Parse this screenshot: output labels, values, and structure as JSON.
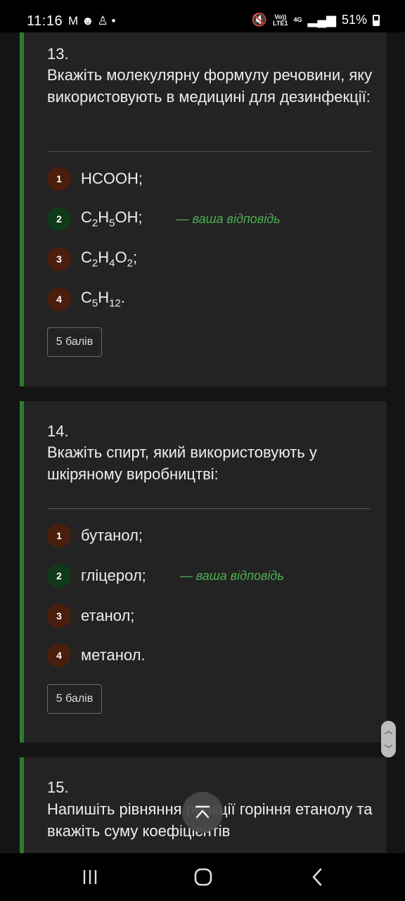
{
  "status_bar": {
    "time": "11:16",
    "notification_icons": [
      "mail-icon",
      "panda-icon",
      "person-icon",
      "dot-icon"
    ],
    "volte_top": "Vo))",
    "volte_bottom": "LTE1",
    "network": "4G",
    "battery": "51%"
  },
  "questions": [
    {
      "number": "13.",
      "text": "Вкажіть молекулярну формулу речовини, яку використовують в медицині для дезинфекції:",
      "options": [
        {
          "index": "1",
          "label_html": "HCOOH;"
        },
        {
          "index": "2",
          "label_html": "C<sub>2</sub>H<sub>5</sub>OH;",
          "selected": true
        },
        {
          "index": "3",
          "label_html": "C<sub>2</sub>H<sub>4</sub>O<sub>2</sub>;"
        },
        {
          "index": "4",
          "label_html": "C<sub>5</sub>H<sub>12</sub>."
        }
      ],
      "your_answer_label": "— ваша відповідь",
      "points": "5 балів"
    },
    {
      "number": "14.",
      "text": "Вкажіть спирт, який використовують у шкіряному виробництві:",
      "options": [
        {
          "index": "1",
          "label_html": "бутанол;"
        },
        {
          "index": "2",
          "label_html": "гліцерол;",
          "selected": true
        },
        {
          "index": "3",
          "label_html": "етанол;"
        },
        {
          "index": "4",
          "label_html": "метанол."
        }
      ],
      "your_answer_label": "— ваша відповідь",
      "points": "5 балів"
    },
    {
      "number": "15.",
      "text": "Напишіть рівняння реакції горіння етанолу та вкажіть суму коефіцієнтів"
    }
  ],
  "colors": {
    "accent_green": "#2a7d2e",
    "answer_green": "#4caf50",
    "badge_brown": "#4a1e0c",
    "badge_green": "#0f3a18"
  },
  "fab": {
    "icon": "scroll-to-top-icon"
  },
  "nav": {
    "icons": [
      "recent-apps-icon",
      "home-icon",
      "back-icon"
    ]
  }
}
